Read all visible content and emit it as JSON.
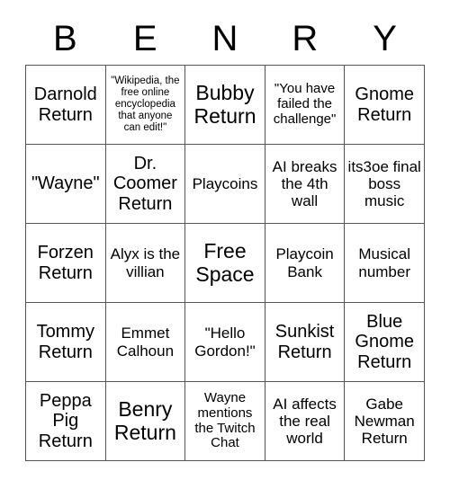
{
  "card": {
    "title_letters": [
      "B",
      "E",
      "N",
      "R",
      "Y"
    ],
    "columns": 5,
    "rows": 5,
    "free_space_label": "Free Space",
    "border_color": "#555555",
    "text_color": "#000000",
    "background_color": "#ffffff",
    "cells": [
      [
        {
          "text": "Darnold Return",
          "size": "lg"
        },
        {
          "text": "\"Wikipedia, the free online encyclopedia that anyone can edit!\"",
          "size": "xs"
        },
        {
          "text": "Bubby Return",
          "size": "xl"
        },
        {
          "text": "\"You have failed the challenge\"",
          "size": "sm"
        },
        {
          "text": "Gnome Return",
          "size": "lg"
        }
      ],
      [
        {
          "text": "\"Wayne\"",
          "size": "lg"
        },
        {
          "text": "Dr. Coomer Return",
          "size": "lg"
        },
        {
          "text": "Playcoins",
          "size": "md"
        },
        {
          "text": "AI breaks the 4th wall",
          "size": "md"
        },
        {
          "text": "its3oe final boss music",
          "size": "md"
        }
      ],
      [
        {
          "text": "Forzen Return",
          "size": "lg"
        },
        {
          "text": "Alyx is the villian",
          "size": "md"
        },
        {
          "text": "Free Space",
          "size": "xl"
        },
        {
          "text": "Playcoin Bank",
          "size": "md"
        },
        {
          "text": "Musical number",
          "size": "md"
        }
      ],
      [
        {
          "text": "Tommy Return",
          "size": "lg"
        },
        {
          "text": "Emmet Calhoun",
          "size": "md"
        },
        {
          "text": "\"Hello Gordon!\"",
          "size": "md"
        },
        {
          "text": "Sunkist Return",
          "size": "lg"
        },
        {
          "text": "Blue Gnome Return",
          "size": "lg"
        }
      ],
      [
        {
          "text": "Peppa Pig Return",
          "size": "lg"
        },
        {
          "text": "Benry Return",
          "size": "xl"
        },
        {
          "text": "Wayne mentions the Twitch Chat",
          "size": "sm"
        },
        {
          "text": "AI affects the real world",
          "size": "md"
        },
        {
          "text": "Gabe Newman Return",
          "size": "md"
        }
      ]
    ]
  }
}
